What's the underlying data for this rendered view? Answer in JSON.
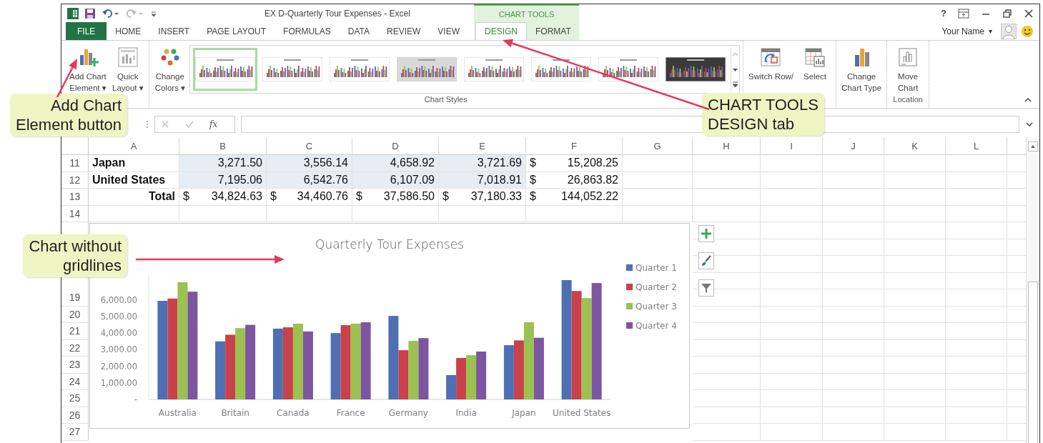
{
  "title_bar": {
    "title": "EX D-Quarterly Tour Expenses - Excel",
    "help": "?",
    "context_header": "CHART TOOLS"
  },
  "tabs": [
    {
      "label": "FILE",
      "kind": "file",
      "selected": false
    },
    {
      "label": "HOME",
      "kind": "normal",
      "selected": false
    },
    {
      "label": "INSERT",
      "kind": "normal",
      "selected": false
    },
    {
      "label": "PAGE LAYOUT",
      "kind": "normal",
      "selected": false
    },
    {
      "label": "FORMULAS",
      "kind": "normal",
      "selected": false
    },
    {
      "label": "DATA",
      "kind": "normal",
      "selected": false
    },
    {
      "label": "REVIEW",
      "kind": "normal",
      "selected": false
    },
    {
      "label": "VIEW",
      "kind": "normal",
      "selected": false
    },
    {
      "label": "DESIGN",
      "kind": "context",
      "selected": true
    },
    {
      "label": "FORMAT",
      "kind": "context",
      "selected": false
    }
  ],
  "account": {
    "user_name": "Your Name",
    "menu_caret": "▾"
  },
  "ribbon": {
    "groups": [
      {
        "items": [
          {
            "kind": "add_element",
            "lines": [
              "Add Chart",
              "Element ▾"
            ]
          },
          {
            "kind": "quick_layout",
            "lines": [
              "Quick",
              "Layout ▾"
            ]
          }
        ]
      },
      {
        "label": "Chart Styles",
        "items": [
          {
            "kind": "change_colors",
            "lines": [
              "Change",
              "Colors ▾"
            ]
          },
          {
            "kind": "gallery",
            "styles": [
              {
                "kind": "light",
                "selected": true
              },
              {
                "kind": "light",
                "selected": false
              },
              {
                "kind": "light",
                "selected": false
              },
              {
                "kind": "gray",
                "selected": false
              },
              {
                "kind": "light",
                "selected": false
              },
              {
                "kind": "light",
                "selected": false
              },
              {
                "kind": "light",
                "selected": false
              },
              {
                "kind": "dark",
                "selected": false
              }
            ]
          }
        ]
      },
      {
        "items": [
          {
            "kind": "switch_row",
            "lines": [
              "Switch Row/"
            ]
          },
          {
            "kind": "select_data",
            "lines": [
              "Select"
            ]
          }
        ]
      },
      {
        "items": [
          {
            "kind": "change_type",
            "lines": [
              "Change",
              "Chart Type"
            ]
          }
        ]
      },
      {
        "label": "Location",
        "items": [
          {
            "kind": "move_chart",
            "lines": [
              "Move",
              "Chart"
            ]
          }
        ]
      }
    ]
  },
  "formula_bar": {
    "function_button": "fx"
  },
  "sheet": {
    "columns": [
      "A",
      "B",
      "C",
      "D",
      "E",
      "F",
      "G",
      "H",
      "I",
      "J",
      "K",
      "L"
    ],
    "rows": [
      {
        "number": "11",
        "highlighted": true,
        "cells": [
          {
            "kind": "label",
            "text": "Japan"
          },
          {
            "kind": "number",
            "text": "3,271.50"
          },
          {
            "kind": "number",
            "text": "3,556.14"
          },
          {
            "kind": "number",
            "text": "4,658.92"
          },
          {
            "kind": "number",
            "text": "3,721.69"
          },
          {
            "kind": "currency",
            "symbol": "$",
            "text": "15,208.25"
          }
        ]
      },
      {
        "number": "12",
        "highlighted": true,
        "cells": [
          {
            "kind": "label",
            "text": "United States"
          },
          {
            "kind": "number",
            "text": "7,195.06"
          },
          {
            "kind": "number",
            "text": "6,542.76"
          },
          {
            "kind": "number",
            "text": "6,107.09"
          },
          {
            "kind": "number",
            "text": "7,018.91"
          },
          {
            "kind": "currency",
            "symbol": "$",
            "text": "26,863.82"
          }
        ]
      },
      {
        "number": "13",
        "highlighted": false,
        "cells": [
          {
            "kind": "total",
            "text": "Total"
          },
          {
            "kind": "currency",
            "symbol": "$",
            "text": "34,824.63"
          },
          {
            "kind": "currency",
            "symbol": "$",
            "text": "34,460.76"
          },
          {
            "kind": "currency",
            "symbol": "$",
            "text": "37,586.50"
          },
          {
            "kind": "currency",
            "symbol": "$",
            "text": "37,180.33"
          },
          {
            "kind": "currency",
            "symbol": "$",
            "text": "144,052.22"
          }
        ]
      },
      {
        "number": "14"
      }
    ],
    "lower_row_numbers": [
      "19",
      "20",
      "21",
      "22",
      "23",
      "24",
      "25",
      "26",
      "27"
    ]
  },
  "chart": {
    "chart_data": {
      "type": "bar",
      "title": "Quarterly Tour Expenses",
      "categories": [
        "Australia",
        "Britain",
        "Canada",
        "France",
        "Germany",
        "India",
        "Japan",
        "United States"
      ],
      "series": [
        {
          "name": "Quarter 1",
          "color": "#4f6fb3",
          "values": [
            5950,
            3500,
            4270,
            4000,
            5040,
            1470,
            3270,
            7200
          ]
        },
        {
          "name": "Quarter 2",
          "color": "#c8414b",
          "values": [
            6080,
            3900,
            4350,
            4480,
            2970,
            2500,
            3560,
            6540
          ]
        },
        {
          "name": "Quarter 3",
          "color": "#9bc150",
          "values": [
            7070,
            4300,
            4570,
            4570,
            3530,
            2670,
            4660,
            6110
          ]
        },
        {
          "name": "Quarter 4",
          "color": "#7e55a0",
          "values": [
            6500,
            4500,
            4100,
            4650,
            3700,
            2890,
            3720,
            7020
          ]
        }
      ],
      "legend": true,
      "ylim": [
        0,
        7500
      ],
      "yticks": [
        {
          "value": 0,
          "label": "-"
        },
        {
          "value": 1000,
          "label": "1,000.00"
        },
        {
          "value": 2000,
          "label": "2,000.00"
        },
        {
          "value": 3000,
          "label": "3,000.00"
        },
        {
          "value": 4000,
          "label": "4,000.00"
        },
        {
          "value": 5000,
          "label": "5,000.00"
        },
        {
          "value": 6000,
          "label": "6,000.00"
        }
      ]
    }
  },
  "callouts": [
    {
      "lines": [
        "Add Chart",
        "Element button"
      ]
    },
    {
      "lines": [
        "CHART TOOLS",
        "DESIGN tab"
      ]
    },
    {
      "lines": [
        "Chart without",
        "gridlines"
      ]
    }
  ]
}
